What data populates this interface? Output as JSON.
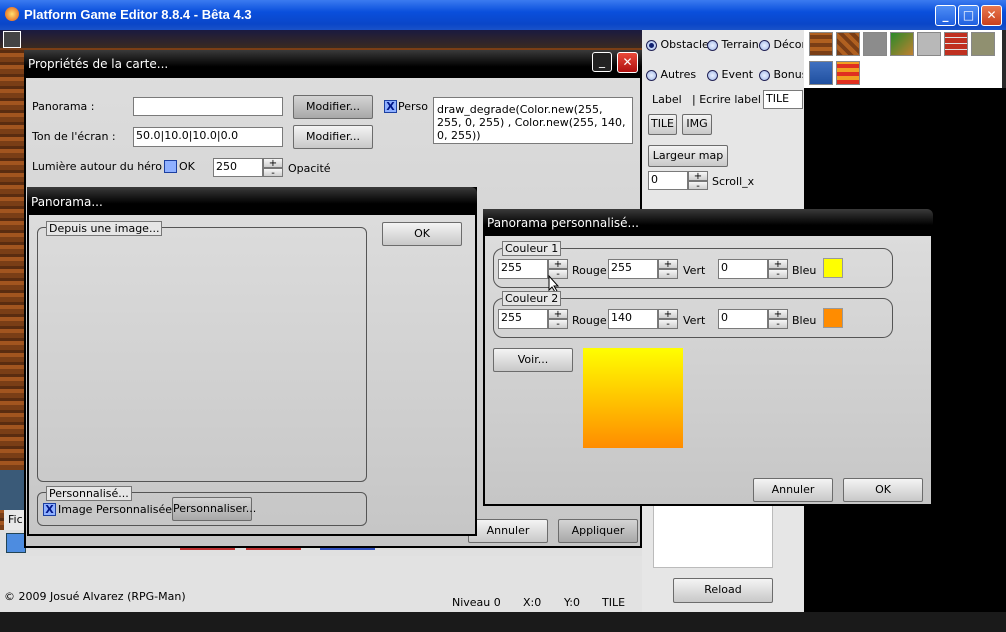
{
  "window": {
    "title": "Platform Game Editor 8.8.4 - Bêta 4.3"
  },
  "right_panel": {
    "radios": [
      {
        "label": "Obstacle",
        "selected": true
      },
      {
        "label": "Terrain",
        "selected": false
      },
      {
        "label": "Décor",
        "selected": false
      },
      {
        "label": "Autres",
        "selected": false
      },
      {
        "label": "Event",
        "selected": false
      },
      {
        "label": "Bonus",
        "selected": false
      }
    ],
    "label_text": "Label",
    "write_label_text": "| Ecrire label :",
    "write_label_value": "TILE",
    "tile_btn": "TILE",
    "img_btn": "IMG",
    "largeur_btn": "Largeur map",
    "scroll_value": "0",
    "scroll_label": "Scroll_x",
    "reload_btn": "Reload"
  },
  "status": {
    "copyright": "© 2009 Josué Alvarez (RPG-Man)",
    "niveau": "Niveau 0",
    "x": "X:0",
    "y": "Y:0",
    "mode": "TILE",
    "menu_fragment": "Fic"
  },
  "props_dialog": {
    "title": "Propriétés de la carte...",
    "panorama_label": "Panorama :",
    "panorama_value": "",
    "modifier_btn": "Modifier...",
    "perso_label": "Perso",
    "perso_checked": "X",
    "code_text": "draw_degrade(Color.new(255, 255, 0, 255) , Color.new(255, 140, 0, 255))",
    "ton_label": "Ton de l'écran :",
    "ton_value": "50.0|10.0|10.0|0.0",
    "lumiere_label": "Lumière autour du héro :",
    "ok_label": "OK",
    "opacity_value": "250",
    "opacity_label": "Opacité",
    "annuler_btn": "Annuler",
    "appliquer_btn": "Appliquer"
  },
  "panorama_dialog": {
    "title": "Panorama...",
    "group_image": "Depuis une image...",
    "ok_btn": "OK",
    "group_perso": "Personnalisé...",
    "image_perso_checked": "X",
    "image_perso_label": "Image Personnalisée.",
    "personnaliser_btn": "Personnaliser..."
  },
  "custom_dialog": {
    "title": "Panorama personnalisé...",
    "color1": {
      "title": "Couleur 1",
      "r": "255",
      "g": "255",
      "b": "0",
      "swatch": "#ffff00"
    },
    "color2": {
      "title": "Couleur 2",
      "r": "255",
      "g": "140",
      "b": "0",
      "swatch": "#ff8c00"
    },
    "rouge": "Rouge",
    "vert": "Vert",
    "bleu": "Bleu",
    "voir_btn": "Voir...",
    "annuler_btn": "Annuler",
    "ok_btn": "OK"
  }
}
